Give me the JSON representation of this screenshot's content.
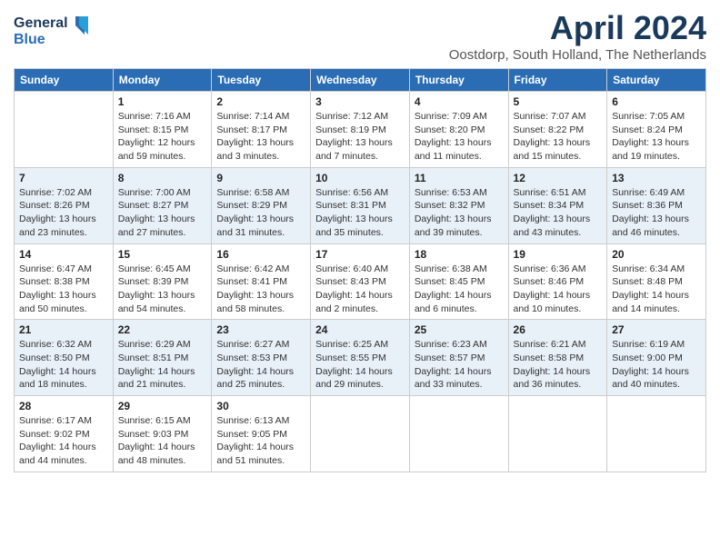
{
  "header": {
    "logo_line1": "General",
    "logo_line2": "Blue",
    "month_title": "April 2024",
    "location": "Oostdorp, South Holland, The Netherlands"
  },
  "weekdays": [
    "Sunday",
    "Monday",
    "Tuesday",
    "Wednesday",
    "Thursday",
    "Friday",
    "Saturday"
  ],
  "weeks": [
    [
      {
        "day": "",
        "info": ""
      },
      {
        "day": "1",
        "info": "Sunrise: 7:16 AM\nSunset: 8:15 PM\nDaylight: 12 hours\nand 59 minutes."
      },
      {
        "day": "2",
        "info": "Sunrise: 7:14 AM\nSunset: 8:17 PM\nDaylight: 13 hours\nand 3 minutes."
      },
      {
        "day": "3",
        "info": "Sunrise: 7:12 AM\nSunset: 8:19 PM\nDaylight: 13 hours\nand 7 minutes."
      },
      {
        "day": "4",
        "info": "Sunrise: 7:09 AM\nSunset: 8:20 PM\nDaylight: 13 hours\nand 11 minutes."
      },
      {
        "day": "5",
        "info": "Sunrise: 7:07 AM\nSunset: 8:22 PM\nDaylight: 13 hours\nand 15 minutes."
      },
      {
        "day": "6",
        "info": "Sunrise: 7:05 AM\nSunset: 8:24 PM\nDaylight: 13 hours\nand 19 minutes."
      }
    ],
    [
      {
        "day": "7",
        "info": "Sunrise: 7:02 AM\nSunset: 8:26 PM\nDaylight: 13 hours\nand 23 minutes."
      },
      {
        "day": "8",
        "info": "Sunrise: 7:00 AM\nSunset: 8:27 PM\nDaylight: 13 hours\nand 27 minutes."
      },
      {
        "day": "9",
        "info": "Sunrise: 6:58 AM\nSunset: 8:29 PM\nDaylight: 13 hours\nand 31 minutes."
      },
      {
        "day": "10",
        "info": "Sunrise: 6:56 AM\nSunset: 8:31 PM\nDaylight: 13 hours\nand 35 minutes."
      },
      {
        "day": "11",
        "info": "Sunrise: 6:53 AM\nSunset: 8:32 PM\nDaylight: 13 hours\nand 39 minutes."
      },
      {
        "day": "12",
        "info": "Sunrise: 6:51 AM\nSunset: 8:34 PM\nDaylight: 13 hours\nand 43 minutes."
      },
      {
        "day": "13",
        "info": "Sunrise: 6:49 AM\nSunset: 8:36 PM\nDaylight: 13 hours\nand 46 minutes."
      }
    ],
    [
      {
        "day": "14",
        "info": "Sunrise: 6:47 AM\nSunset: 8:38 PM\nDaylight: 13 hours\nand 50 minutes."
      },
      {
        "day": "15",
        "info": "Sunrise: 6:45 AM\nSunset: 8:39 PM\nDaylight: 13 hours\nand 54 minutes."
      },
      {
        "day": "16",
        "info": "Sunrise: 6:42 AM\nSunset: 8:41 PM\nDaylight: 13 hours\nand 58 minutes."
      },
      {
        "day": "17",
        "info": "Sunrise: 6:40 AM\nSunset: 8:43 PM\nDaylight: 14 hours\nand 2 minutes."
      },
      {
        "day": "18",
        "info": "Sunrise: 6:38 AM\nSunset: 8:45 PM\nDaylight: 14 hours\nand 6 minutes."
      },
      {
        "day": "19",
        "info": "Sunrise: 6:36 AM\nSunset: 8:46 PM\nDaylight: 14 hours\nand 10 minutes."
      },
      {
        "day": "20",
        "info": "Sunrise: 6:34 AM\nSunset: 8:48 PM\nDaylight: 14 hours\nand 14 minutes."
      }
    ],
    [
      {
        "day": "21",
        "info": "Sunrise: 6:32 AM\nSunset: 8:50 PM\nDaylight: 14 hours\nand 18 minutes."
      },
      {
        "day": "22",
        "info": "Sunrise: 6:29 AM\nSunset: 8:51 PM\nDaylight: 14 hours\nand 21 minutes."
      },
      {
        "day": "23",
        "info": "Sunrise: 6:27 AM\nSunset: 8:53 PM\nDaylight: 14 hours\nand 25 minutes."
      },
      {
        "day": "24",
        "info": "Sunrise: 6:25 AM\nSunset: 8:55 PM\nDaylight: 14 hours\nand 29 minutes."
      },
      {
        "day": "25",
        "info": "Sunrise: 6:23 AM\nSunset: 8:57 PM\nDaylight: 14 hours\nand 33 minutes."
      },
      {
        "day": "26",
        "info": "Sunrise: 6:21 AM\nSunset: 8:58 PM\nDaylight: 14 hours\nand 36 minutes."
      },
      {
        "day": "27",
        "info": "Sunrise: 6:19 AM\nSunset: 9:00 PM\nDaylight: 14 hours\nand 40 minutes."
      }
    ],
    [
      {
        "day": "28",
        "info": "Sunrise: 6:17 AM\nSunset: 9:02 PM\nDaylight: 14 hours\nand 44 minutes."
      },
      {
        "day": "29",
        "info": "Sunrise: 6:15 AM\nSunset: 9:03 PM\nDaylight: 14 hours\nand 48 minutes."
      },
      {
        "day": "30",
        "info": "Sunrise: 6:13 AM\nSunset: 9:05 PM\nDaylight: 14 hours\nand 51 minutes."
      },
      {
        "day": "",
        "info": ""
      },
      {
        "day": "",
        "info": ""
      },
      {
        "day": "",
        "info": ""
      },
      {
        "day": "",
        "info": ""
      }
    ]
  ]
}
